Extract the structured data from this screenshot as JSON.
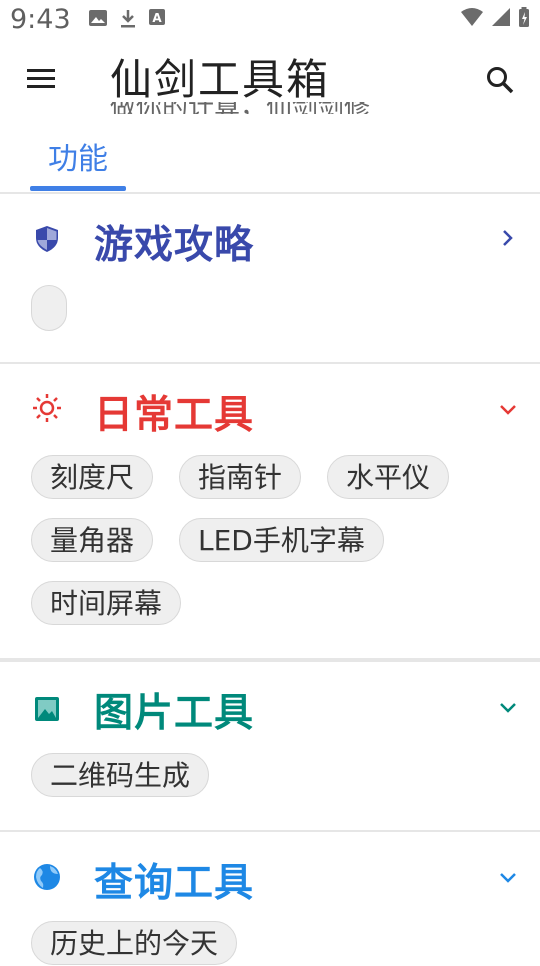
{
  "status_bar": {
    "time": "9:43",
    "icons": [
      "image-icon",
      "download-icon",
      "font-icon",
      "wifi-icon",
      "signal-icon",
      "battery-icon"
    ]
  },
  "app_bar": {
    "title": "仙剑工具箱",
    "subtitle": "做你的计算，仙剑剑修",
    "icons": [
      "menu-icon",
      "search-icon"
    ]
  },
  "tabs": [
    {
      "label": "功能",
      "active": true,
      "color": "#3f7fe6"
    }
  ],
  "sections": [
    {
      "title": "游戏攻略",
      "color": "#3949ab",
      "icon": "shield-icon",
      "chevron": "chevron-right-icon",
      "chips": []
    },
    {
      "title": "日常工具",
      "color": "#e53935",
      "icon": "sun-icon",
      "chevron": "chevron-down-icon",
      "chips": [
        "刻度尺",
        "指南针",
        "水平仪",
        "量角器",
        "LED手机字幕",
        "时间屏幕"
      ]
    },
    {
      "title": "图片工具",
      "color": "#00897b",
      "icon": "image-icon",
      "chevron": "chevron-down-icon",
      "chips": [
        "二维码生成"
      ]
    },
    {
      "title": "查询工具",
      "color": "#1e88e5",
      "icon": "globe-icon",
      "chevron": "chevron-down-icon",
      "chips": [
        "历史上的今天"
      ]
    }
  ]
}
